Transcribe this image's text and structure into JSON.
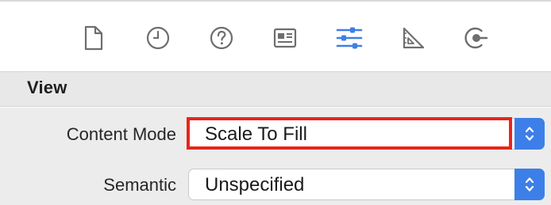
{
  "toolbar": {
    "icons": [
      {
        "name": "file-inspector-icon",
        "selected": false
      },
      {
        "name": "history-inspector-icon",
        "selected": false
      },
      {
        "name": "quick-help-icon",
        "selected": false
      },
      {
        "name": "identity-inspector-icon",
        "selected": false
      },
      {
        "name": "attributes-inspector-icon",
        "selected": true
      },
      {
        "name": "size-inspector-icon",
        "selected": false
      },
      {
        "name": "connections-inspector-icon",
        "selected": false
      }
    ]
  },
  "section": {
    "title": "View"
  },
  "fields": {
    "content_mode": {
      "label": "Content Mode",
      "value": "Scale To Fill"
    },
    "semantic": {
      "label": "Semantic",
      "value": "Unspecified"
    }
  },
  "colors": {
    "accent": "#3d7fe8",
    "icon": "#6e6e6e",
    "highlight": "#e8251b",
    "header_bg": "#e8e8e8",
    "form_bg": "#ececec"
  }
}
